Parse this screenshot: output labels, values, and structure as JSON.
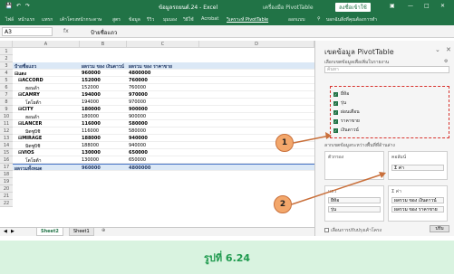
{
  "window": {
    "title": "ข้อมูลรถยนต์.24 - Excel",
    "context_tab": "เครื่องมือ PivotTable",
    "signin": "ลงชื่อเข้าใช้"
  },
  "ribbon": {
    "tabs": [
      "ไฟล์",
      "หน้าแรก",
      "แทรก",
      "เค้าโครงหน้ากระดาษ",
      "สูตร",
      "ข้อมูล",
      "รีวิว",
      "มุมมอง",
      "วิธีใช้",
      "Acrobat",
      "วิเคราะห์ PivotTable",
      "ออกแบบ"
    ],
    "tell_me": "บอกฉันสิ่งที่คุณต้องการทำ"
  },
  "formula_bar": {
    "name_box": "A3",
    "fx": "fx",
    "value": "ป้ายชื่อแถว"
  },
  "grid": {
    "columns": [
      "A",
      "B",
      "C",
      "D"
    ],
    "row_numbers": [
      "1",
      "2",
      "3",
      "4",
      "5",
      "6",
      "7",
      "8",
      "9",
      "10",
      "11",
      "12",
      "13",
      "14",
      "15",
      "16",
      "17",
      "18",
      "19",
      "20",
      "21",
      "22"
    ],
    "pivot_header": [
      "ป้ายชื่อแถว",
      "ผลรวม ของ เงินดาวน์",
      "ผลรวม ของ ราคาขาย"
    ],
    "rows": [
      {
        "label": "⊟แดง",
        "down": "960000",
        "price": "4800000",
        "bold": true
      },
      {
        "label": "⊟ACCORD",
        "down": "152000",
        "price": "760000",
        "bold": true
      },
      {
        "label": "ฮอนด้า",
        "down": "152000",
        "price": "760000",
        "bold": false
      },
      {
        "label": "⊟CAMRY",
        "down": "194000",
        "price": "970000",
        "bold": true
      },
      {
        "label": "โตโยต้า",
        "down": "194000",
        "price": "970000",
        "bold": false
      },
      {
        "label": "⊟CITY",
        "down": "180000",
        "price": "900000",
        "bold": true
      },
      {
        "label": "ฮอนด้า",
        "down": "180000",
        "price": "900000",
        "bold": false
      },
      {
        "label": "⊟LANCER",
        "down": "116000",
        "price": "580000",
        "bold": true
      },
      {
        "label": "มิตซูบิชิ",
        "down": "116000",
        "price": "580000",
        "bold": false
      },
      {
        "label": "⊟MIRAGE",
        "down": "188000",
        "price": "940000",
        "bold": true
      },
      {
        "label": "มิตซูบิชิ",
        "down": "188000",
        "price": "940000",
        "bold": false
      },
      {
        "label": "⊟VIOS",
        "down": "130000",
        "price": "650000",
        "bold": true
      },
      {
        "label": "โตโยต้า",
        "down": "130000",
        "price": "650000",
        "bold": false
      },
      {
        "label": "ผลรวมทั้งหมด",
        "down": "960000",
        "price": "4800000",
        "bold": true
      }
    ]
  },
  "sheets": {
    "tabs": [
      "Sheet2",
      "Sheet1"
    ],
    "add": "⊕"
  },
  "pivot_pane": {
    "title": "เขตข้อมูล PivotTable",
    "subtitle": "เลือกเขตข้อมูลเพื่อเพิ่มในรายงาน",
    "search_placeholder": "ค้นหา",
    "fields": [
      {
        "label": "ยี่ห้อ",
        "checked": true
      },
      {
        "label": "รุ่น",
        "checked": true
      },
      {
        "label": "ผ่อนเดือน",
        "checked": true
      },
      {
        "label": "ราคาขาย",
        "checked": true
      },
      {
        "label": "เงินดาวน์",
        "checked": true
      }
    ],
    "drag_hint": "ลากเขตข้อมูลระหว่างพื้นที่ที่ด้านล่าง",
    "areas": {
      "filters": "ตัวกรอง",
      "columns": "คอลัมน์",
      "columns_item": "Σ ค่า",
      "rows": "แถว",
      "rows_items": [
        "ยี่ห้อ",
        "รุ่น"
      ],
      "values": "Σ ค่า",
      "values_items": [
        "ผลรวม ของ เงินดาวน์",
        "ผลรวม ของ ราคาขาย"
      ]
    },
    "defer": "เลื่อนการปรับปรุงเค้าโครง",
    "update": "ปรับ"
  },
  "callouts": [
    "1",
    "2"
  ],
  "caption": "รูปที่ 6.24",
  "colors": {
    "excel_green": "#217346",
    "callout_orange": "#f3a76b",
    "dashed_red": "#d8332e",
    "caption_green": "#1f9a4e",
    "caption_band": "#d9f3e0"
  }
}
